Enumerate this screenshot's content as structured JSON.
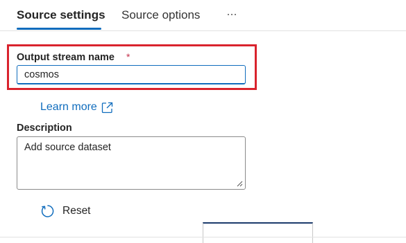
{
  "tabs": {
    "active_label": "Source settings",
    "inactive_label": "Source options",
    "more_label": "···"
  },
  "output_stream": {
    "label": "Output stream name",
    "required_marker": "*",
    "value": "cosmos"
  },
  "learn_more": {
    "label": "Learn more",
    "icon": "open-in-new-icon"
  },
  "description": {
    "label": "Description",
    "value": "Add source dataset"
  },
  "reset": {
    "label": "Reset",
    "icon": "refresh-icon"
  },
  "colors": {
    "accent": "#0f6cbd",
    "highlight": "#d9232d",
    "required": "#c4314b"
  }
}
